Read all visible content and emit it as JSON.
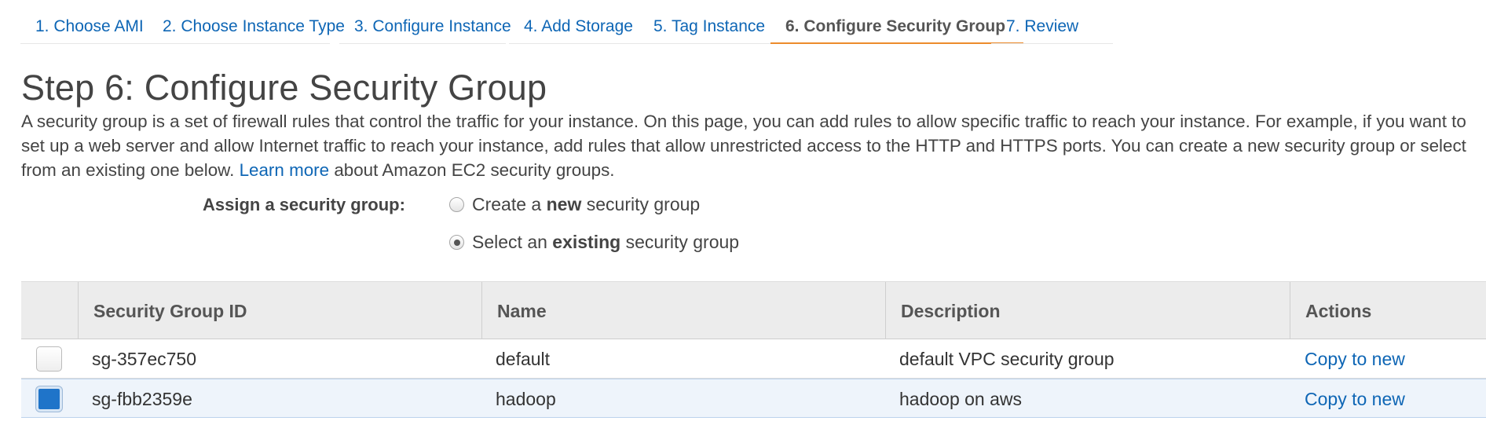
{
  "wizard": {
    "tabs": [
      {
        "label": "1. Choose AMI"
      },
      {
        "label": "2. Choose Instance Type"
      },
      {
        "label": "3. Configure Instance"
      },
      {
        "label": "4. Add Storage"
      },
      {
        "label": "5. Tag Instance"
      },
      {
        "label": "6. Configure Security Group"
      },
      {
        "label": "7. Review"
      }
    ],
    "active_tab": "6. Configure Security Group",
    "accent_color": "#ec8b2c",
    "link_color": "#0e66b5"
  },
  "page": {
    "title": "Step 6: Configure Security Group",
    "intro": "A security group is a set of firewall rules that control the traffic for your instance. On this page, you can add rules to allow specific traffic to reach your instance. For example, if you want to set up a web server and allow Internet traffic to reach your instance, add rules that allow unrestricted access to the HTTP and HTTPS ports. You can create a new security group or select from an existing one below.",
    "learn_more": "Learn more",
    "intro_suffix": "about Amazon EC2 security groups."
  },
  "assign": {
    "label": "Assign a security group:",
    "option_create": {
      "prefix": "Create a ",
      "bold": "new",
      "suffix": " security group",
      "checked": false
    },
    "option_existing": {
      "prefix": "Select an ",
      "bold": "existing",
      "suffix": " security group",
      "checked": true
    }
  },
  "table": {
    "headers": {
      "id": "Security Group ID",
      "name": "Name",
      "description": "Description",
      "actions": "Actions"
    },
    "rows": [
      {
        "id": "sg-357ec750",
        "name": "default",
        "description": "default VPC security group",
        "action": "Copy to new",
        "selected": false
      },
      {
        "id": "sg-fbb2359e",
        "name": "hadoop",
        "description": "hadoop on aws",
        "action": "Copy to new",
        "selected": true
      }
    ]
  }
}
